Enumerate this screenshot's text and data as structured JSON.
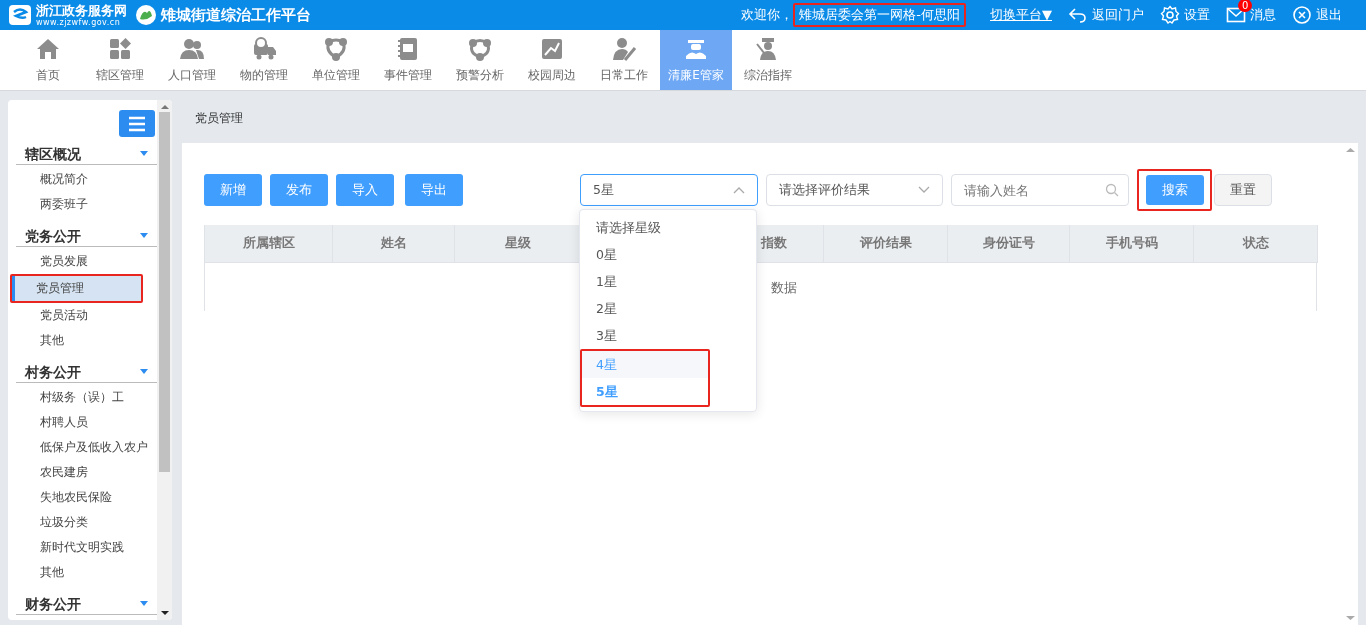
{
  "header": {
    "portal_name": "浙江政务服务网",
    "portal_url": "www.zjzwfw.gov.cn",
    "platform_title": "雉城街道综治工作平台",
    "welcome": "欢迎你，",
    "user": "雉城居委会第一网格-何思阳",
    "user_highlighted": true,
    "switch_platform": "切换平台▼",
    "actions": [
      {
        "label": "返回门户"
      },
      {
        "label": "设置"
      },
      {
        "label": "消息",
        "badge": "0"
      },
      {
        "label": "退出"
      }
    ]
  },
  "nav": [
    {
      "label": "首页",
      "selected": false
    },
    {
      "label": "辖区管理",
      "selected": false
    },
    {
      "label": "人口管理",
      "selected": false
    },
    {
      "label": "物的管理",
      "selected": false
    },
    {
      "label": "单位管理",
      "selected": false
    },
    {
      "label": "事件管理",
      "selected": false
    },
    {
      "label": "预警分析",
      "selected": false
    },
    {
      "label": "校园周边",
      "selected": false
    },
    {
      "label": "日常工作",
      "selected": false
    },
    {
      "label": "清廉E管家",
      "selected": true
    },
    {
      "label": "综治指挥",
      "selected": false
    }
  ],
  "sidebar": {
    "groups": [
      {
        "title": "辖区概况",
        "expanded": true,
        "items": [
          {
            "label": "概况简介",
            "selected": false,
            "highlighted": false
          },
          {
            "label": "两委班子",
            "selected": false,
            "highlighted": false
          }
        ]
      },
      {
        "title": "党务公开",
        "expanded": true,
        "items": [
          {
            "label": "党员发展",
            "selected": false,
            "highlighted": false
          },
          {
            "label": "党员管理",
            "selected": true,
            "highlighted": true
          },
          {
            "label": "党员活动",
            "selected": false,
            "highlighted": false
          },
          {
            "label": "其他",
            "selected": false,
            "highlighted": false
          }
        ]
      },
      {
        "title": "村务公开",
        "expanded": true,
        "items": [
          {
            "label": "村级务（误）工",
            "selected": false,
            "highlighted": false
          },
          {
            "label": "村聘人员",
            "selected": false,
            "highlighted": false
          },
          {
            "label": "低保户及低收入农户",
            "selected": false,
            "highlighted": false
          },
          {
            "label": "农民建房",
            "selected": false,
            "highlighted": false
          },
          {
            "label": "失地农民保险",
            "selected": false,
            "highlighted": false
          },
          {
            "label": "垃圾分类",
            "selected": false,
            "highlighted": false
          },
          {
            "label": "新时代文明实践",
            "selected": false,
            "highlighted": false
          },
          {
            "label": "其他",
            "selected": false,
            "highlighted": false
          }
        ]
      },
      {
        "title": "财务公开",
        "expanded": true
      }
    ]
  },
  "breadcrumb": "党员管理",
  "toolbar": {
    "buttons": [
      "新增",
      "发布",
      "导入",
      "导出"
    ],
    "star_select": {
      "value": "5星",
      "expanded": true,
      "options": [
        {
          "label": "请选择星级",
          "selected": false,
          "hovered": false,
          "highlighted": false
        },
        {
          "label": "0星",
          "selected": false,
          "hovered": false,
          "highlighted": false
        },
        {
          "label": "1星",
          "selected": false,
          "hovered": false,
          "highlighted": false
        },
        {
          "label": "2星",
          "selected": false,
          "hovered": false,
          "highlighted": false
        },
        {
          "label": "3星",
          "selected": false,
          "hovered": false,
          "highlighted": false
        },
        {
          "label": "4星",
          "selected": false,
          "hovered": true,
          "highlighted": true
        },
        {
          "label": "5星",
          "selected": true,
          "hovered": false,
          "highlighted": true
        }
      ]
    },
    "result_select": {
      "placeholder": "请选择评价结果"
    },
    "name_field": {
      "placeholder": "请输入姓名"
    },
    "search_button": "搜索",
    "search_highlighted": true,
    "reset_button": "重置"
  },
  "table": {
    "columns": [
      "所属辖区",
      "姓名",
      "星级",
      "指数",
      "评价结果",
      "身份证号",
      "手机号码",
      "状态"
    ],
    "empty_text": "数据"
  }
}
